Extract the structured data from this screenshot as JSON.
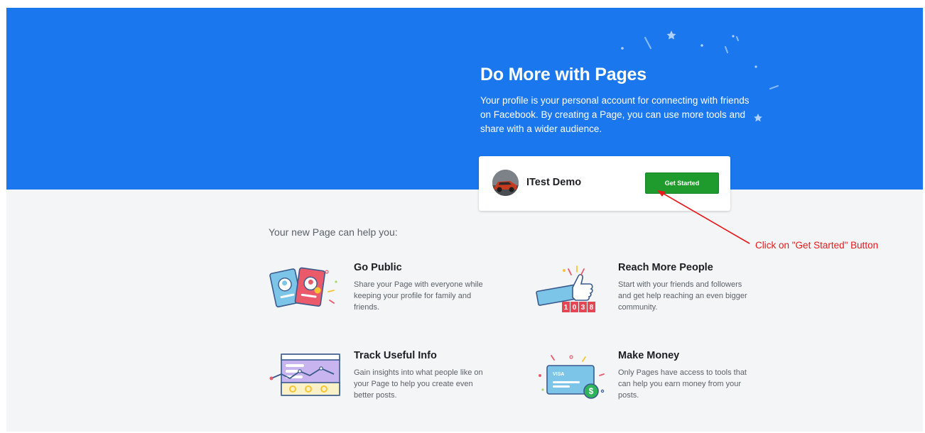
{
  "hero": {
    "title": "Do More with Pages",
    "description": "Your profile is your personal account for connecting with friends on Facebook. By creating a Page, you can use more tools and share with a wider audience.",
    "background_color": "#1b77ee"
  },
  "page_card": {
    "page_name": "ITest Demo",
    "button_label": "Get Started",
    "button_color": "#1f9a2c"
  },
  "benefits": {
    "heading": "Your new Page can help you:",
    "items": [
      {
        "icon": "profile-cards-illustration",
        "title": "Go Public",
        "description": "Share your Page with everyone while keeping your profile for family and friends."
      },
      {
        "icon": "thumbs-up-counter-illustration",
        "title": "Reach More People",
        "description": "Start with your friends and followers and get help reaching an even bigger community.",
        "counter_digits": [
          "1",
          "0",
          "3",
          "8"
        ]
      },
      {
        "icon": "insights-dashboard-illustration",
        "title": "Track Useful Info",
        "description": "Gain insights into what people like on your Page to help you create even better posts."
      },
      {
        "icon": "credit-card-dollar-illustration",
        "title": "Make Money",
        "description": "Only Pages have access to tools that can help you earn money from your posts.",
        "card_brand": "VISA",
        "coin_symbol": "$"
      }
    ]
  },
  "annotation": {
    "text": "Click on \"Get Started\" Button",
    "color": "#e8191a"
  }
}
